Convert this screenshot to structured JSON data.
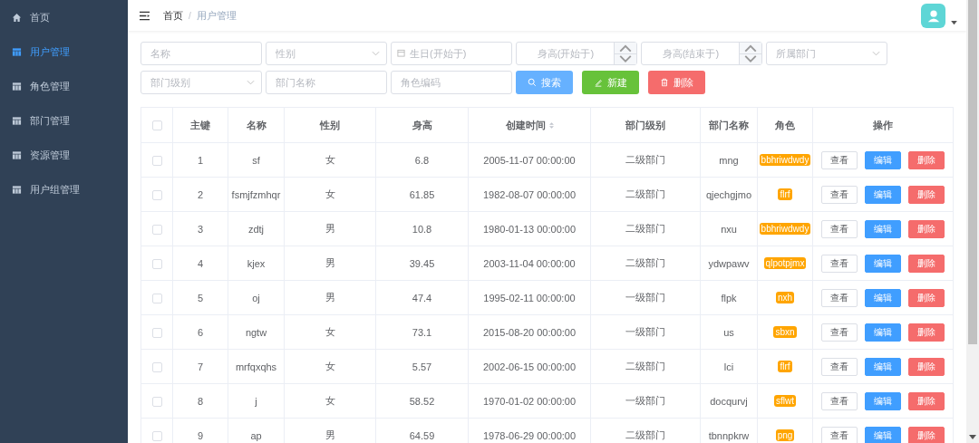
{
  "sidebar": {
    "items": [
      {
        "label": "首页",
        "selected": false
      },
      {
        "label": "用户管理",
        "selected": true
      },
      {
        "label": "角色管理",
        "selected": false
      },
      {
        "label": "部门管理",
        "selected": false
      },
      {
        "label": "资源管理",
        "selected": false
      },
      {
        "label": "用户组管理",
        "selected": false
      }
    ]
  },
  "breadcrumb": [
    "首页",
    "用户管理"
  ],
  "breadcrumb_separator": "/",
  "filters": [
    {
      "kind": "text",
      "placeholder": "名称"
    },
    {
      "kind": "select",
      "placeholder": "性别"
    },
    {
      "kind": "date",
      "placeholder": "生日(开始于)"
    },
    {
      "kind": "number",
      "placeholder": "身高(开始于)"
    },
    {
      "kind": "number",
      "placeholder": "身高(结束于)"
    },
    {
      "kind": "select",
      "placeholder": "所属部门"
    },
    {
      "kind": "select",
      "placeholder": "部门级别"
    },
    {
      "kind": "text",
      "placeholder": "部门名称"
    },
    {
      "kind": "text",
      "placeholder": "角色编码"
    }
  ],
  "actions": [
    {
      "label": "搜索",
      "kind": "search"
    },
    {
      "label": "新建",
      "kind": "create"
    },
    {
      "label": "删除",
      "kind": "delete"
    }
  ],
  "table": {
    "all_checked": false,
    "columns": [
      {
        "label": "主键",
        "sortable": false
      },
      {
        "label": "名称",
        "sortable": false
      },
      {
        "label": "性别",
        "sortable": false
      },
      {
        "label": "身高",
        "sortable": false
      },
      {
        "label": "创建时间",
        "sortable": true
      },
      {
        "label": "部门级别",
        "sortable": false
      },
      {
        "label": "部门名称",
        "sortable": false
      },
      {
        "label": "角色",
        "sortable": false
      },
      {
        "label": "操作",
        "sortable": false
      }
    ],
    "rows": [
      {
        "checked": false,
        "cells": [
          "1",
          "sf",
          "女",
          "6.8",
          "2005-11-07 00:00:00",
          "二级部门",
          "mng"
        ],
        "role": "bbhriwdwdy",
        "buttons": [
          "查看",
          "编辑",
          "删除"
        ]
      },
      {
        "checked": false,
        "cells": [
          "2",
          "fsmjfzmhqr",
          "女",
          "61.85",
          "1982-08-07 00:00:00",
          "二级部门",
          "qjechgjmo"
        ],
        "role": "flrf",
        "buttons": [
          "查看",
          "编辑",
          "删除"
        ]
      },
      {
        "checked": false,
        "cells": [
          "3",
          "zdtj",
          "男",
          "10.8",
          "1980-01-13 00:00:00",
          "二级部门",
          "nxu"
        ],
        "role": "bbhriwdwdy",
        "buttons": [
          "查看",
          "编辑",
          "删除"
        ]
      },
      {
        "checked": false,
        "cells": [
          "4",
          "kjex",
          "男",
          "39.45",
          "2003-11-04 00:00:00",
          "二级部门",
          "ydwpawv"
        ],
        "role": "qlpotpjmx",
        "buttons": [
          "查看",
          "编辑",
          "删除"
        ]
      },
      {
        "checked": false,
        "cells": [
          "5",
          "oj",
          "男",
          "47.4",
          "1995-02-11 00:00:00",
          "一级部门",
          "flpk"
        ],
        "role": "nxh",
        "buttons": [
          "查看",
          "编辑",
          "删除"
        ]
      },
      {
        "checked": false,
        "cells": [
          "6",
          "ngtw",
          "女",
          "73.1",
          "2015-08-20 00:00:00",
          "一级部门",
          "us"
        ],
        "role": "sbxn",
        "buttons": [
          "查看",
          "编辑",
          "删除"
        ]
      },
      {
        "checked": false,
        "cells": [
          "7",
          "mrfqxqhs",
          "女",
          "5.57",
          "2002-06-15 00:00:00",
          "二级部门",
          "lci"
        ],
        "role": "flrf",
        "buttons": [
          "查看",
          "编辑",
          "删除"
        ]
      },
      {
        "checked": false,
        "cells": [
          "8",
          "j",
          "女",
          "58.52",
          "1970-01-02 00:00:00",
          "一级部门",
          "docqurvj"
        ],
        "role": "sflwt",
        "buttons": [
          "查看",
          "编辑",
          "删除"
        ]
      },
      {
        "checked": false,
        "cells": [
          "9",
          "ap",
          "男",
          "64.59",
          "1978-06-29 00:00:00",
          "二级部门",
          "tbnnpkrw"
        ],
        "role": "png",
        "buttons": [
          "查看",
          "编辑",
          "删除"
        ]
      }
    ]
  }
}
